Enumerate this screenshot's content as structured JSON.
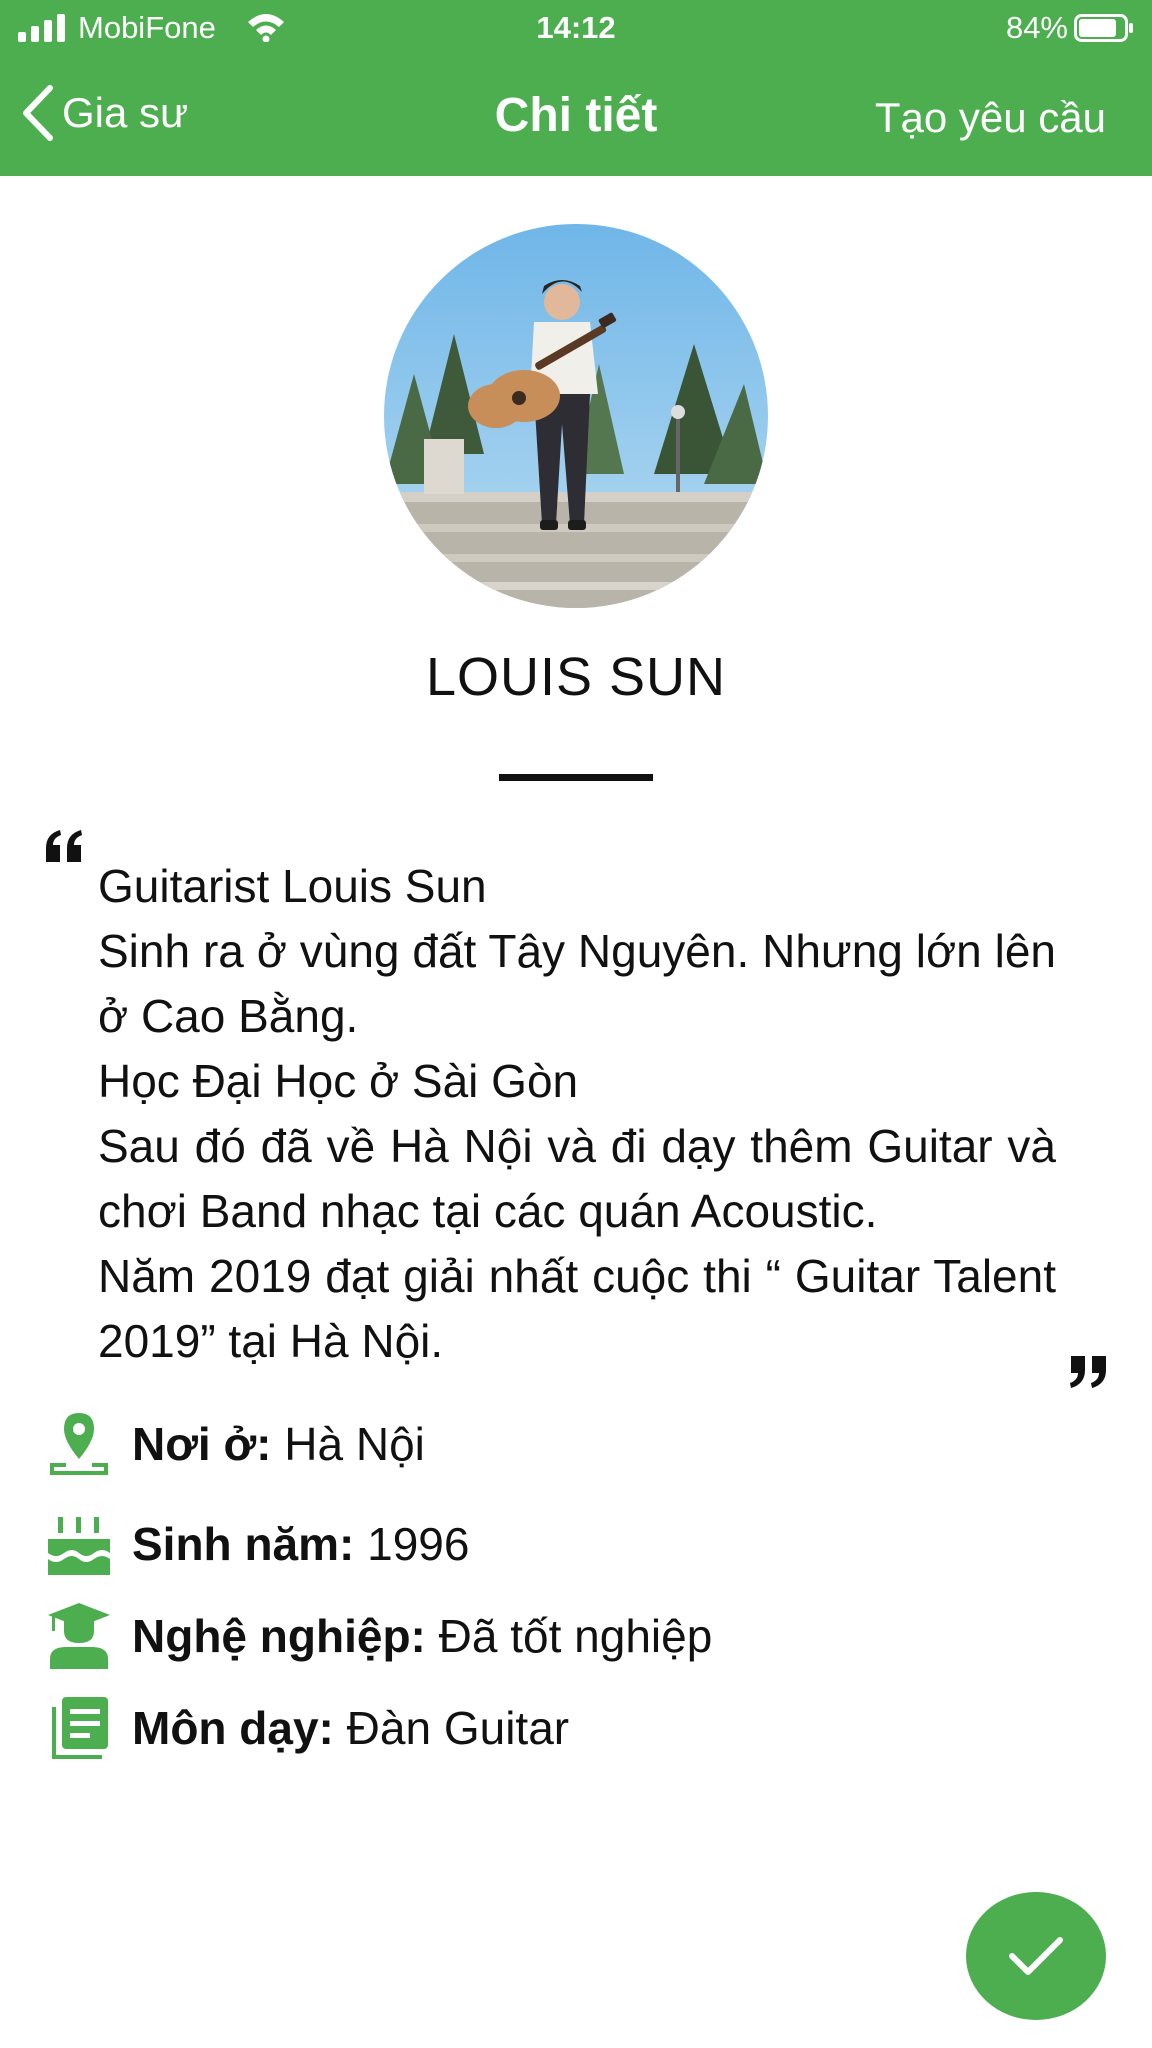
{
  "status_bar": {
    "carrier": "MobiFone",
    "time": "14:12",
    "battery_percent": "84%",
    "battery_level": 0.84
  },
  "nav": {
    "back_label": "Gia sư",
    "title": "Chi tiết",
    "action_label": "Tạo yêu cầu"
  },
  "profile": {
    "name": "LOUIS SUN",
    "bio_lines": [
      "Guitarist Louis Sun",
      "Sinh ra ở vùng đất Tây Nguyên. Nhưng lớn lên ở Cao Bằng.",
      "Học Đại Học ở Sài Gòn",
      "Sau đó đã về Hà Nội và đi dạy thêm Guitar và chơi Band nhạc tại các quán Acoustic.",
      "Năm 2019 đạt giải nhất cuộc thi “ Guitar Talent 2019” tại Hà Nội."
    ]
  },
  "info": {
    "location": {
      "label": "Nơi ở:",
      "value": " Hà Nội",
      "icon": "location-pin-icon"
    },
    "birth_year": {
      "label": "Sinh năm:",
      "value": " 1996",
      "icon": "birthday-cake-icon"
    },
    "occupation": {
      "label": "Nghệ nghiệp:",
      "value": " Đã tốt nghiệp",
      "icon": "graduate-icon"
    },
    "subject": {
      "label": "Môn dạy:",
      "value": " Đàn Guitar",
      "icon": "book-icon"
    }
  },
  "colors": {
    "accent": "#4cae4f",
    "text": "#111111",
    "background": "#ffffff"
  }
}
